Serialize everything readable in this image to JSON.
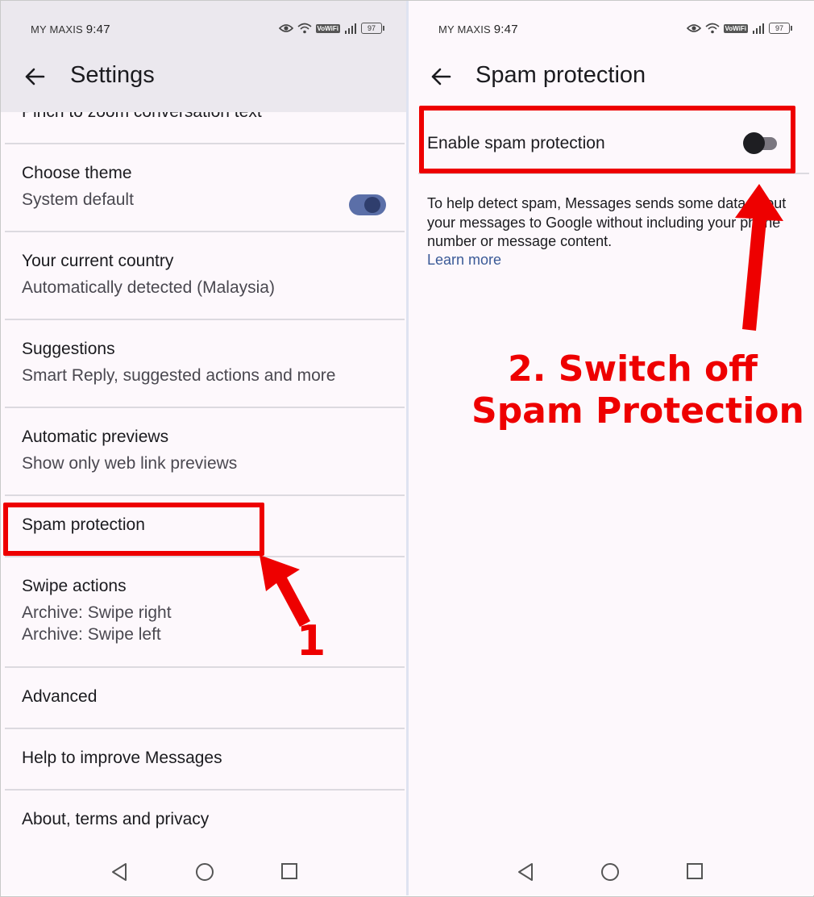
{
  "left_screen": {
    "status": {
      "carrier": "MY MAXIS",
      "time": "9:47",
      "volte": "VoWiFi",
      "battery": "97"
    },
    "title": "Settings",
    "items": [
      {
        "title": "Pinch to zoom conversation text",
        "sub": []
      },
      {
        "title": "Choose theme",
        "sub": [
          "System default"
        ]
      },
      {
        "title": "Your current country",
        "sub": [
          "Automatically detected (Malaysia)"
        ]
      },
      {
        "title": "Suggestions",
        "sub": [
          "Smart Reply, suggested actions and more"
        ]
      },
      {
        "title": "Automatic previews",
        "sub": [
          "Show only web link previews"
        ]
      },
      {
        "title": "Spam protection",
        "sub": []
      },
      {
        "title": "Swipe actions",
        "sub": [
          "Archive: Swipe right",
          "Archive: Swipe left"
        ]
      },
      {
        "title": "Advanced",
        "sub": []
      },
      {
        "title": "Help to improve Messages",
        "sub": []
      },
      {
        "title": "About, terms and privacy",
        "sub": []
      }
    ]
  },
  "right_screen": {
    "status": {
      "carrier": "MY MAXIS",
      "time": "9:47",
      "volte": "VoWiFi",
      "battery": "97"
    },
    "title": "Spam protection",
    "setting_label": "Enable spam protection",
    "toggle_on": false,
    "description": "To help detect spam, Messages sends some data about your messages to Google without including your phone number or message content.",
    "learn_more": "Learn more"
  },
  "annotations": {
    "step1": "1",
    "step2_line1": "2. Switch off",
    "step2_line2": "Spam Protection",
    "color": "#ee0000"
  },
  "icons": [
    "back-arrow-icon",
    "eye-icon",
    "wifi-icon",
    "signal-icon",
    "battery-icon",
    "nav-back-icon",
    "nav-home-icon",
    "nav-recents-icon"
  ]
}
